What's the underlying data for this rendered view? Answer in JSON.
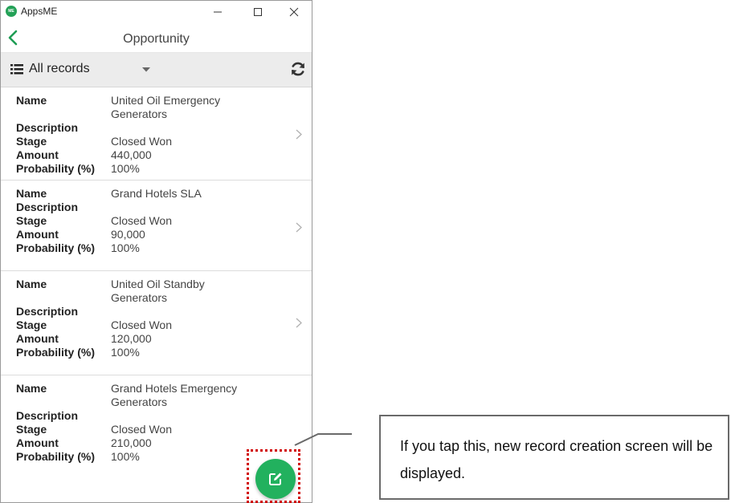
{
  "window": {
    "app_title": "AppsME",
    "logo_text": "ME"
  },
  "nav": {
    "title": "Opportunity"
  },
  "filter": {
    "label": "All records"
  },
  "records": [
    {
      "name_label": "Name",
      "name": "United Oil Emergency Generators",
      "description_label": "Description",
      "description": "",
      "stage_label": "Stage",
      "stage": "Closed Won",
      "amount_label": "Amount",
      "amount": "440,000",
      "probability_label": "Probability (%)",
      "probability": "100%"
    },
    {
      "name_label": "Name",
      "name": "Grand Hotels SLA",
      "description_label": "Description",
      "description": "",
      "stage_label": "Stage",
      "stage": "Closed Won",
      "amount_label": "Amount",
      "amount": "90,000",
      "probability_label": "Probability (%)",
      "probability": "100%"
    },
    {
      "name_label": "Name",
      "name": "United Oil Standby Generators",
      "description_label": "Description",
      "description": "",
      "stage_label": "Stage",
      "stage": "Closed Won",
      "amount_label": "Amount",
      "amount": "120,000",
      "probability_label": "Probability (%)",
      "probability": "100%"
    },
    {
      "name_label": "Name",
      "name": "Grand Hotels Emergency Generators",
      "description_label": "Description",
      "description": "",
      "stage_label": "Stage",
      "stage": "Closed Won",
      "amount_label": "Amount",
      "amount": "210,000",
      "probability_label": "Probability (%)",
      "probability": "100%"
    }
  ],
  "callout": {
    "text": "If you tap this, new record creation screen will be displayed."
  },
  "colors": {
    "accent_green": "#22b15e",
    "highlight_red": "#d10000"
  }
}
